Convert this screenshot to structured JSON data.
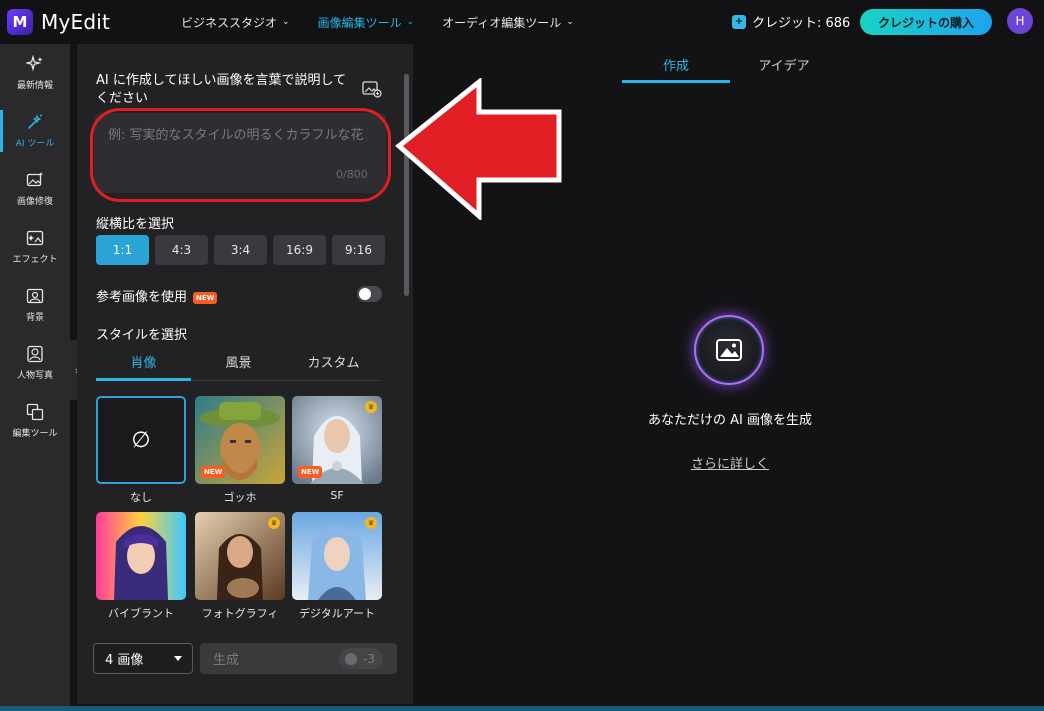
{
  "app": {
    "name": "MyEdit",
    "logo_letter": "M"
  },
  "topnav": [
    {
      "label": "ビジネススタジオ",
      "active": false
    },
    {
      "label": "画像編集ツール",
      "active": true
    },
    {
      "label": "オーディオ編集ツール",
      "active": false
    }
  ],
  "credits": {
    "label": "クレジット: 686",
    "buy_label": "クレジットの購入"
  },
  "user": {
    "avatar_initial": "H"
  },
  "rail": [
    {
      "label": "最新情報",
      "icon": "sparkles-icon"
    },
    {
      "label": "AI ツール",
      "icon": "magic-wand-icon",
      "active": true
    },
    {
      "label": "画像修復",
      "icon": "image-repair-icon"
    },
    {
      "label": "エフェクト",
      "icon": "effect-icon"
    },
    {
      "label": "背景",
      "icon": "background-icon"
    },
    {
      "label": "人物写真",
      "icon": "portrait-icon"
    },
    {
      "label": "編集ツール",
      "icon": "edit-tools-icon"
    }
  ],
  "prompt": {
    "title": "AI に作成してほしい画像を言葉で説明してください",
    "placeholder": "例: 写実的なスタイルの明るくカラフルな花",
    "counter": "0/800"
  },
  "aspect": {
    "label": "縦横比を選択",
    "options": [
      "1:1",
      "4:3",
      "3:4",
      "16:9",
      "9:16"
    ],
    "selected": "1:1"
  },
  "reference": {
    "label": "参考画像を使用",
    "badge": "NEW",
    "enabled": false
  },
  "style": {
    "label": "スタイルを選択",
    "tabs": [
      "肖像",
      "風景",
      "カスタム"
    ],
    "active_tab": "肖像",
    "cards": [
      {
        "label": "なし",
        "symbol": "∅",
        "selected": true
      },
      {
        "label": "ゴッホ",
        "badge": "NEW"
      },
      {
        "label": "SF",
        "badge": "NEW",
        "premium": true
      },
      {
        "label": "バイブラント"
      },
      {
        "label": "フォトグラフィ",
        "premium": true
      },
      {
        "label": "デジタルアート",
        "premium": true
      }
    ]
  },
  "footer": {
    "count_label": "4 画像",
    "generate_label": "生成",
    "cost": "-3"
  },
  "right": {
    "tabs": [
      "作成",
      "アイデア"
    ],
    "active_tab": "作成",
    "message": "あなただけの AI 画像を生成",
    "link": "さらに詳しく"
  },
  "colors": {
    "accent": "#29b6e6",
    "highlight": "#e11e24",
    "new_badge": "#ff5a1f"
  }
}
